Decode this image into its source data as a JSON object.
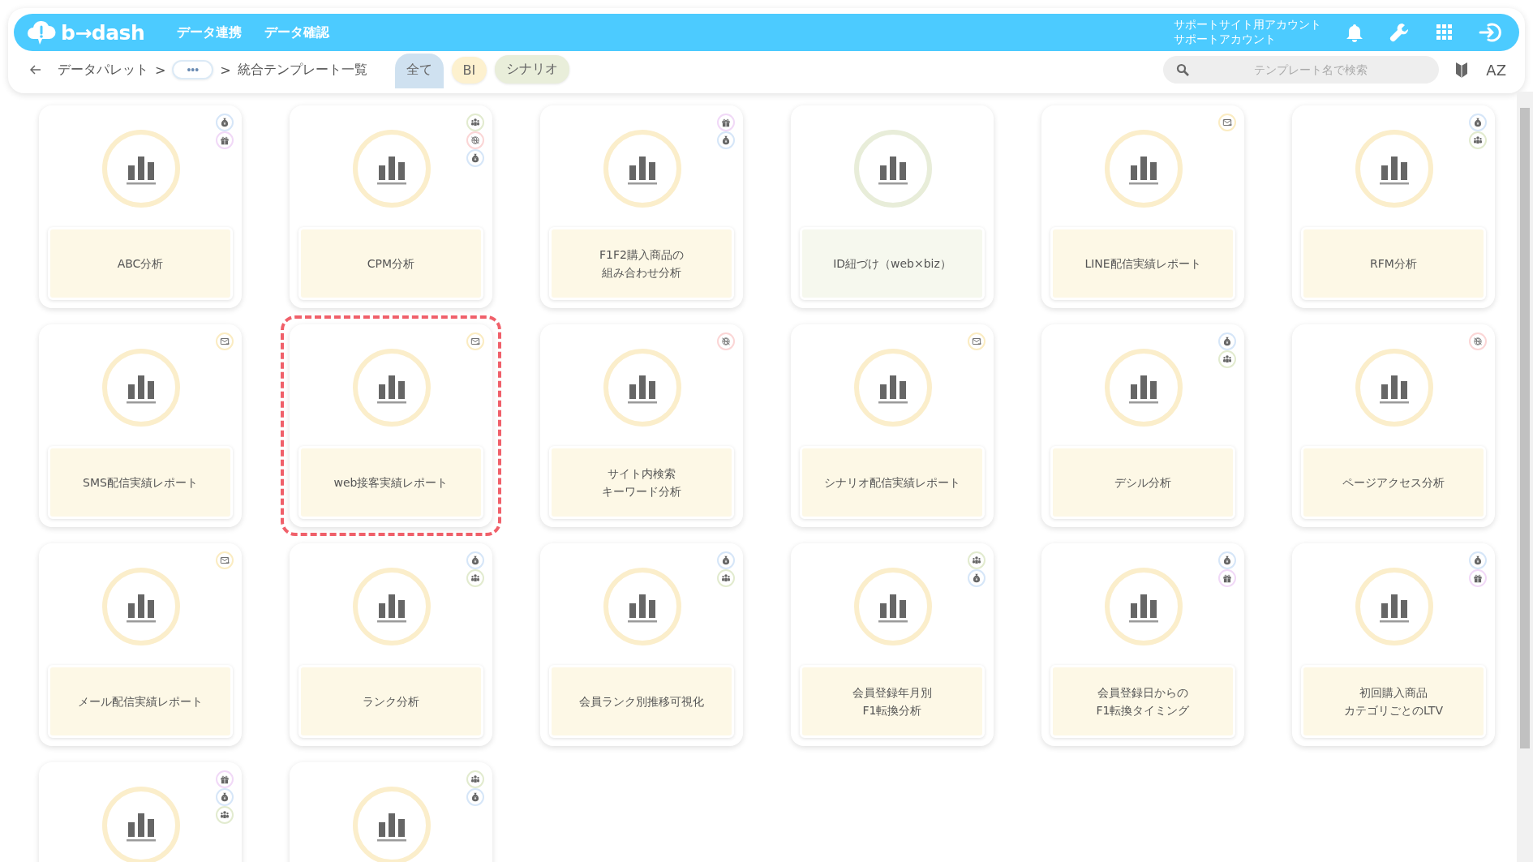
{
  "header": {
    "logo": "b→dash",
    "nav": [
      "データ連携",
      "データ確認"
    ],
    "account": [
      "サポートサイト用アカウント",
      "サポートアカウント"
    ]
  },
  "breadcrumb": {
    "items": [
      "データパレット",
      "統合テンプレート一覧"
    ],
    "more": "•••",
    "separator": ">"
  },
  "tabs": [
    {
      "label": "全て",
      "selected": true,
      "color": "#cfe1f0"
    },
    {
      "label": "BI",
      "selected": false,
      "color": "#fdf1cf"
    },
    {
      "label": "シナリオ",
      "selected": false,
      "color": "#e9eeda"
    }
  ],
  "search": {
    "placeholder": "テンプレート名で検索"
  },
  "sort_label": "AZ",
  "cards": [
    {
      "title": [
        "ABC分析"
      ],
      "kind": "bi",
      "selected": false,
      "tags": [
        {
          "kind": "money"
        },
        {
          "kind": "gift"
        }
      ]
    },
    {
      "title": [
        "CPM分析"
      ],
      "kind": "bi",
      "selected": false,
      "tags": [
        {
          "kind": "people"
        },
        {
          "kind": "globe"
        },
        {
          "kind": "money"
        }
      ]
    },
    {
      "title": [
        "F1F2購入商品の",
        "組み合わせ分析"
      ],
      "kind": "bi",
      "selected": false,
      "tags": [
        {
          "kind": "gift"
        },
        {
          "kind": "money"
        }
      ]
    },
    {
      "title": [
        "ID紐づけ（web×biz）"
      ],
      "kind": "scenario",
      "selected": false
    },
    {
      "title": [
        "LINE配信実績レポート"
      ],
      "kind": "bi",
      "selected": false,
      "tags": [
        {
          "kind": "mail"
        }
      ]
    },
    {
      "title": [
        "RFM分析"
      ],
      "kind": "bi",
      "selected": false,
      "tags": [
        {
          "kind": "money"
        },
        {
          "kind": "people"
        }
      ]
    },
    {
      "title": [
        "SMS配信実績レポート"
      ],
      "kind": "bi",
      "selected": false,
      "tags": [
        {
          "kind": "mail"
        }
      ]
    },
    {
      "title": [
        "web接客実績レポート"
      ],
      "kind": "bi",
      "selected": true,
      "tags": [
        {
          "kind": "mail"
        }
      ]
    },
    {
      "title": [
        "サイト内検索",
        "キーワード分析"
      ],
      "kind": "bi",
      "selected": false,
      "tags": [
        {
          "kind": "globe"
        }
      ]
    },
    {
      "title": [
        "シナリオ配信実績レポート"
      ],
      "kind": "bi",
      "selected": false,
      "tags": [
        {
          "kind": "mail"
        }
      ]
    },
    {
      "title": [
        "デシル分析"
      ],
      "kind": "bi",
      "selected": false,
      "tags": [
        {
          "kind": "money"
        },
        {
          "kind": "people"
        }
      ]
    },
    {
      "title": [
        "ページアクセス分析"
      ],
      "kind": "bi",
      "selected": false,
      "tags": [
        {
          "kind": "globe"
        }
      ]
    },
    {
      "title": [
        "メール配信実績レポート"
      ],
      "kind": "bi",
      "selected": false,
      "tags": [
        {
          "kind": "mail"
        }
      ]
    },
    {
      "title": [
        "ランク分析"
      ],
      "kind": "bi",
      "selected": false,
      "tags": [
        {
          "kind": "money"
        },
        {
          "kind": "people"
        }
      ]
    },
    {
      "title": [
        "会員ランク別推移可視化"
      ],
      "kind": "bi",
      "selected": false,
      "tags": [
        {
          "kind": "money"
        },
        {
          "kind": "people"
        }
      ]
    },
    {
      "title": [
        "会員登録年月別",
        "F1転換分析"
      ],
      "kind": "bi",
      "selected": false,
      "tags": [
        {
          "kind": "people"
        },
        {
          "kind": "money"
        }
      ]
    },
    {
      "title": [
        "会員登録日からの",
        "F1転換タイミング"
      ],
      "kind": "bi",
      "selected": false,
      "tags": [
        {
          "kind": "money"
        },
        {
          "kind": "gift"
        }
      ]
    },
    {
      "title": [
        "初回購入商品",
        "カテゴリごとのLTV"
      ],
      "kind": "bi",
      "selected": false,
      "tags": [
        {
          "kind": "money"
        },
        {
          "kind": "gift"
        }
      ]
    },
    {
      "kind": "bi",
      "selected": false,
      "tags": [
        {
          "kind": "gift"
        },
        {
          "kind": "money"
        },
        {
          "kind": "people"
        }
      ]
    },
    {
      "kind": "bi",
      "selected": false,
      "tags": [
        {
          "kind": "people"
        },
        {
          "kind": "money"
        }
      ]
    }
  ]
}
